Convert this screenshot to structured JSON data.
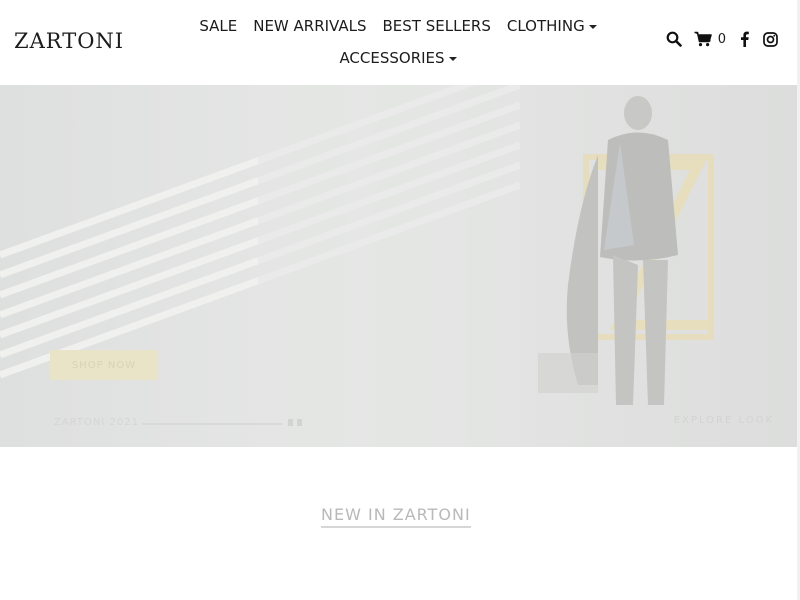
{
  "brand": {
    "logo_text": "ZARTONI"
  },
  "nav": {
    "row1": [
      {
        "label": "SALE",
        "dropdown": false
      },
      {
        "label": "NEW ARRIVALS",
        "dropdown": false
      },
      {
        "label": "BEST SELLERS",
        "dropdown": false
      },
      {
        "label": "CLOTHING",
        "dropdown": true
      }
    ],
    "row2": [
      {
        "label": "ACCESSORIES",
        "dropdown": true
      }
    ]
  },
  "header_icons": {
    "search": "search-icon",
    "cart": "cart-icon",
    "cart_count": "0",
    "facebook": "facebook-icon",
    "instagram": "instagram-icon"
  },
  "hero": {
    "button_label": "SHOP NOW",
    "left_caption": "ZARTONI 2021",
    "right_caption": "EXPLORE LOOK"
  },
  "section": {
    "title": "NEW IN ZARTONI"
  },
  "colors": {
    "text": "#1c1c1c",
    "hero_bg": "#e3e4e4",
    "accent_gold": "#e9e3c8",
    "section_title": "#b9b9b9"
  }
}
